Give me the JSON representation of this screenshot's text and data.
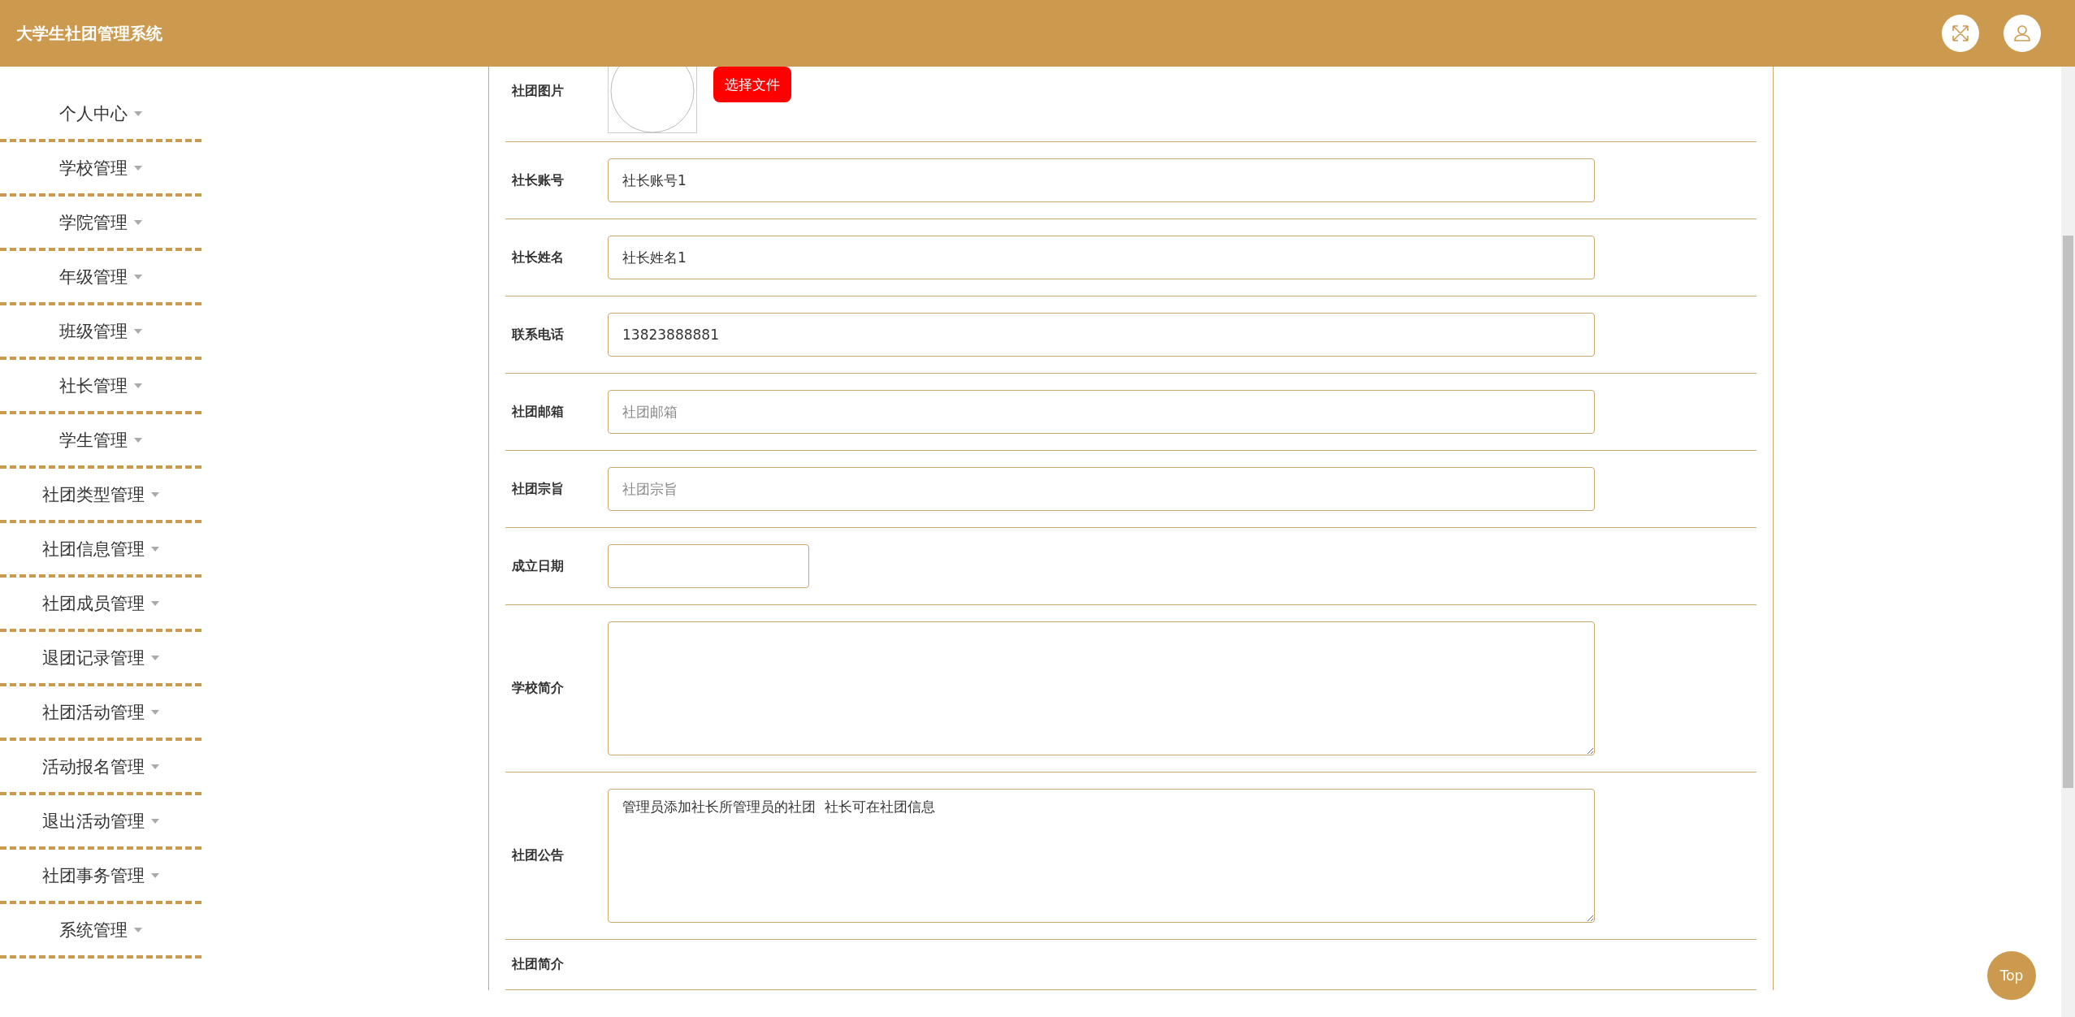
{
  "header": {
    "title": "大学生社团管理系统"
  },
  "sidebar": {
    "items": [
      {
        "label": "个人中心"
      },
      {
        "label": "学校管理"
      },
      {
        "label": "学院管理"
      },
      {
        "label": "年级管理"
      },
      {
        "label": "班级管理"
      },
      {
        "label": "社长管理"
      },
      {
        "label": "学生管理"
      },
      {
        "label": "社团类型管理"
      },
      {
        "label": "社团信息管理"
      },
      {
        "label": "社团成员管理"
      },
      {
        "label": "退团记录管理"
      },
      {
        "label": "社团活动管理"
      },
      {
        "label": "活动报名管理"
      },
      {
        "label": "退出活动管理"
      },
      {
        "label": "社团事务管理"
      },
      {
        "label": "系统管理"
      }
    ]
  },
  "form": {
    "rows": [
      {
        "kind": "image",
        "label": "社团图片",
        "button": "选择文件"
      },
      {
        "kind": "input",
        "label": "社长账号",
        "value": "社长账号1"
      },
      {
        "kind": "input",
        "label": "社长姓名",
        "value": "社长姓名1"
      },
      {
        "kind": "input",
        "label": "联系电话",
        "value": "13823888881"
      },
      {
        "kind": "input",
        "label": "社团邮箱",
        "placeholder": "社团邮箱"
      },
      {
        "kind": "input",
        "label": "社团宗旨",
        "placeholder": "社团宗旨"
      },
      {
        "kind": "date",
        "label": "成立日期"
      },
      {
        "kind": "textarea",
        "label": "学校简介"
      },
      {
        "kind": "textarea",
        "label": "社团公告",
        "value": "管理员添加社长所管理员的社团  社长可在社团信息"
      },
      {
        "kind": "label",
        "label": "社团简介"
      }
    ]
  },
  "back_to_top": {
    "label": "Top"
  }
}
